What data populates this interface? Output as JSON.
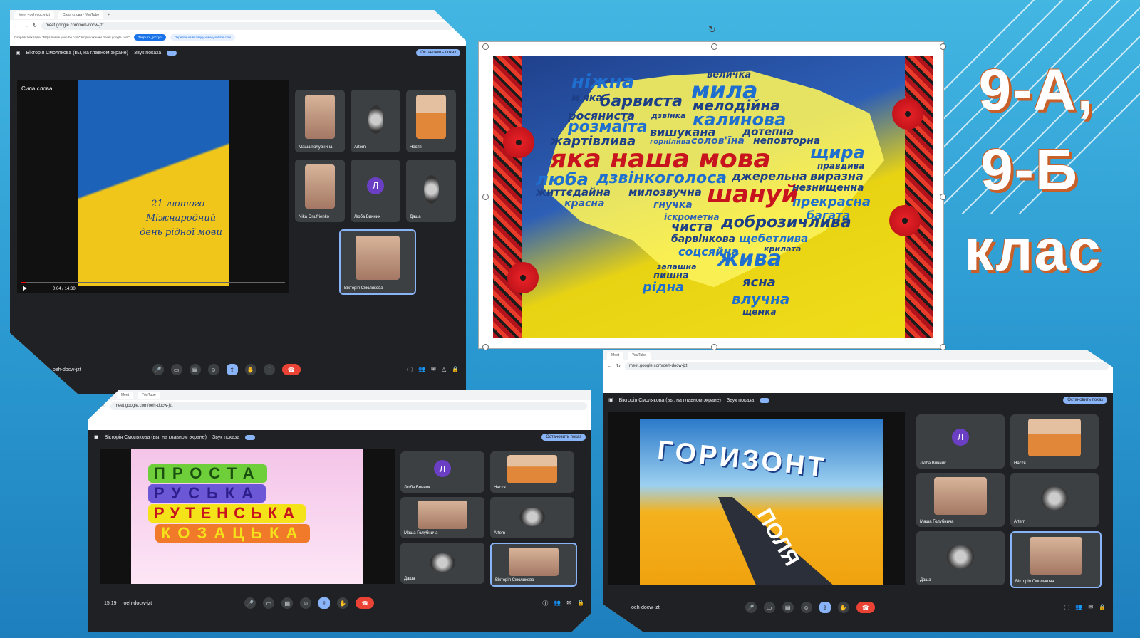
{
  "grade_heading": {
    "line1": "9-А,",
    "line2": "9-Б",
    "line3": "клас"
  },
  "screens": [
    {
      "url": "meet.google.com/oeh-docw-jzt",
      "tab1": "Meet - oeh-docw-jzt",
      "tab2": "Сила слова - YouTube",
      "notice": "Отправка вкладки \"https://www.youtube.com\" в приложении \"meet.google.com\"",
      "allow_label": "Закрыть доступ",
      "switch_label": "Перейти на вкладку www.youtube.com",
      "presenter": "Вікторія Смолякова (вы, на главном экране)",
      "sound_label": "Звук показа",
      "stop_label": "Остановить показ",
      "video_title": "Сила слова",
      "video_caption": "21 лютого - Міжнародний день рідної мови",
      "video_time": "0:04 / 14:30",
      "meeting_code": "oeh-docw-jzt",
      "participants": [
        "Маша Голубнича",
        "Artem",
        "Настя",
        "Nika Onufrienko",
        "Люба Винник",
        "Даша",
        "Вікторія Смолякова"
      ]
    },
    {
      "url": "meet.google.com/oeh-docw-jzt",
      "presenter": "Вікторія Смолякова (вы, на главном экране)",
      "sound_label": "Звук показа",
      "stop_label": "Остановить показ",
      "puzzle_rows": [
        "ПРОСТА",
        "РУСЬКА",
        "РУТЕНСЬКА",
        "КОЗАЦЬКА"
      ],
      "time": "15:19",
      "meeting_code": "oeh-docw-jzt",
      "participants": [
        "Люба Винник",
        "Настя",
        "Маша Голубнича",
        "Artem",
        "Даша",
        "Вікторія Смолякова"
      ]
    },
    {
      "url": "meet.google.com/oeh-docw-jzt",
      "presenter": "Вікторія Смолякова (вы, на главном экране)",
      "sound_label": "Звук показа",
      "stop_label": "Остановить показ",
      "slide_title": "ГОРИЗОНТ",
      "road_text": "ПОЛЯ",
      "meeting_code": "oeh-docw-jzt",
      "participants": [
        "Люба Винник",
        "Настя",
        "Маша Голубнича",
        "Artem",
        "Даша",
        "Вікторія Смолякова"
      ]
    }
  ],
  "word_cloud": {
    "headline": "яка наша мова",
    "highlight": "шануй",
    "words": [
      "ніжна",
      "величка",
      "мила",
      "м'яка",
      "барвиста",
      "мелодійна",
      "росяниста",
      "дзвінка",
      "калинова",
      "розмаїта",
      "вишукана",
      "дотепна",
      "жартівлива",
      "горнілива",
      "солов'їна",
      "неповторна",
      "щира",
      "правдива",
      "люба",
      "дзвінкоголоса",
      "джерельна",
      "виразна",
      "життєдайна",
      "милозвучна",
      "незнищенна",
      "красна",
      "гнучка",
      "прекрасна",
      "багата",
      "іскрометна",
      "чиста",
      "доброзичлива",
      "барвінкова",
      "щебетлива",
      "крилата",
      "соцсяйна",
      "жива",
      "запашна",
      "пишна",
      "рідна",
      "ясна",
      "влучна",
      "щемка"
    ]
  }
}
